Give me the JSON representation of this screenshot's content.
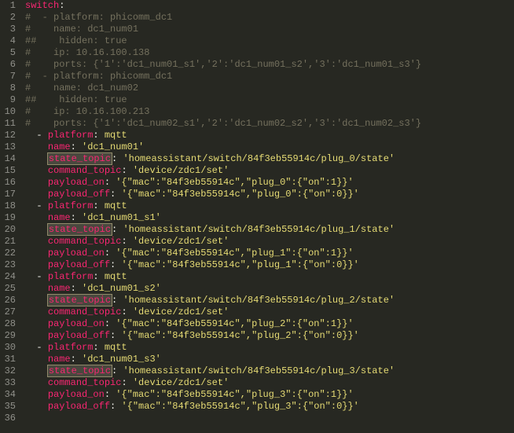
{
  "line_start": 1,
  "line_end": 36,
  "lines": [
    {
      "tokens": [
        {
          "t": "switch",
          "c": "key"
        },
        {
          "t": ":",
          "c": "punct"
        }
      ]
    },
    {
      "tokens": [
        {
          "t": "#  - platform: phicomm_dc1",
          "c": "cmt"
        }
      ]
    },
    {
      "tokens": [
        {
          "t": "#    name: dc1_num01",
          "c": "cmt"
        }
      ]
    },
    {
      "tokens": [
        {
          "t": "##    hidden: true",
          "c": "cmt"
        }
      ]
    },
    {
      "tokens": [
        {
          "t": "#    ip: 10.16.100.138",
          "c": "cmt"
        }
      ]
    },
    {
      "tokens": [
        {
          "t": "#    ports: {'1':'dc1_num01_s1','2':'dc1_num01_s2','3':'dc1_num01_s3'}",
          "c": "cmt"
        }
      ]
    },
    {
      "tokens": [
        {
          "t": "#  - platform: phicomm_dc1",
          "c": "cmt"
        }
      ]
    },
    {
      "tokens": [
        {
          "t": "#    name: dc1_num02",
          "c": "cmt"
        }
      ]
    },
    {
      "tokens": [
        {
          "t": "##    hidden: true",
          "c": "cmt"
        }
      ]
    },
    {
      "tokens": [
        {
          "t": "#    ip: 10.16.100.213",
          "c": "cmt"
        }
      ]
    },
    {
      "tokens": [
        {
          "t": "#    ports: {'1':'dc1_num02_s1','2':'dc1_num02_s2','3':'dc1_num02_s3'}",
          "c": "cmt"
        }
      ]
    },
    {
      "indent": "  ",
      "tokens": [
        {
          "t": "- ",
          "c": "punct"
        },
        {
          "t": "platform",
          "c": "key"
        },
        {
          "t": ": ",
          "c": "punct"
        },
        {
          "t": "mqtt",
          "c": "str"
        }
      ]
    },
    {
      "indent": "    ",
      "tokens": [
        {
          "t": "name",
          "c": "key"
        },
        {
          "t": ": ",
          "c": "punct"
        },
        {
          "t": "'dc1_num01'",
          "c": "str"
        }
      ]
    },
    {
      "indent": "    ",
      "tokens": [
        {
          "t": "state_topic",
          "c": "key",
          "sel": true
        },
        {
          "t": ": ",
          "c": "punct"
        },
        {
          "t": "'homeassistant/switch/84f3eb55914c/plug_0/state'",
          "c": "str"
        }
      ]
    },
    {
      "indent": "    ",
      "tokens": [
        {
          "t": "command_topic",
          "c": "key"
        },
        {
          "t": ": ",
          "c": "punct"
        },
        {
          "t": "'device/zdc1/set'",
          "c": "str"
        }
      ]
    },
    {
      "indent": "    ",
      "tokens": [
        {
          "t": "payload_on",
          "c": "key"
        },
        {
          "t": ": ",
          "c": "punct"
        },
        {
          "t": "'{\"mac\":\"84f3eb55914c\",\"plug_0\":{\"on\":1}}'",
          "c": "str"
        }
      ]
    },
    {
      "indent": "    ",
      "tokens": [
        {
          "t": "payload_off",
          "c": "key"
        },
        {
          "t": ": ",
          "c": "punct"
        },
        {
          "t": "'{\"mac\":\"84f3eb55914c\",\"plug_0\":{\"on\":0}}'",
          "c": "str"
        }
      ]
    },
    {
      "indent": "  ",
      "tokens": [
        {
          "t": "- ",
          "c": "punct"
        },
        {
          "t": "platform",
          "c": "key"
        },
        {
          "t": ": ",
          "c": "punct"
        },
        {
          "t": "mqtt",
          "c": "str"
        }
      ]
    },
    {
      "indent": "    ",
      "tokens": [
        {
          "t": "name",
          "c": "key"
        },
        {
          "t": ": ",
          "c": "punct"
        },
        {
          "t": "'dc1_num01_s1'",
          "c": "str"
        }
      ]
    },
    {
      "indent": "    ",
      "tokens": [
        {
          "t": "state_topic",
          "c": "key",
          "sel": true
        },
        {
          "t": ": ",
          "c": "punct"
        },
        {
          "t": "'homeassistant/switch/84f3eb55914c/plug_1/state'",
          "c": "str"
        }
      ]
    },
    {
      "indent": "    ",
      "tokens": [
        {
          "t": "command_topic",
          "c": "key"
        },
        {
          "t": ": ",
          "c": "punct"
        },
        {
          "t": "'device/zdc1/set'",
          "c": "str"
        }
      ]
    },
    {
      "indent": "    ",
      "tokens": [
        {
          "t": "payload_on",
          "c": "key"
        },
        {
          "t": ": ",
          "c": "punct"
        },
        {
          "t": "'{\"mac\":\"84f3eb55914c\",\"plug_1\":{\"on\":1}}'",
          "c": "str"
        }
      ]
    },
    {
      "indent": "    ",
      "tokens": [
        {
          "t": "payload_off",
          "c": "key"
        },
        {
          "t": ": ",
          "c": "punct"
        },
        {
          "t": "'{\"mac\":\"84f3eb55914c\",\"plug_1\":{\"on\":0}}'",
          "c": "str"
        }
      ]
    },
    {
      "indent": "  ",
      "tokens": [
        {
          "t": "- ",
          "c": "punct"
        },
        {
          "t": "platform",
          "c": "key"
        },
        {
          "t": ": ",
          "c": "punct"
        },
        {
          "t": "mqtt",
          "c": "str"
        }
      ]
    },
    {
      "indent": "    ",
      "tokens": [
        {
          "t": "name",
          "c": "key"
        },
        {
          "t": ": ",
          "c": "punct"
        },
        {
          "t": "'dc1_num01_s2'",
          "c": "str"
        }
      ]
    },
    {
      "indent": "    ",
      "tokens": [
        {
          "t": "state_topic",
          "c": "key",
          "sel": true
        },
        {
          "t": ": ",
          "c": "punct"
        },
        {
          "t": "'homeassistant/switch/84f3eb55914c/plug_2/state'",
          "c": "str"
        }
      ]
    },
    {
      "indent": "    ",
      "tokens": [
        {
          "t": "command_topic",
          "c": "key"
        },
        {
          "t": ": ",
          "c": "punct"
        },
        {
          "t": "'device/zdc1/set'",
          "c": "str"
        }
      ]
    },
    {
      "indent": "    ",
      "tokens": [
        {
          "t": "payload_on",
          "c": "key"
        },
        {
          "t": ": ",
          "c": "punct"
        },
        {
          "t": "'{\"mac\":\"84f3eb55914c\",\"plug_2\":{\"on\":1}}'",
          "c": "str"
        }
      ]
    },
    {
      "indent": "    ",
      "tokens": [
        {
          "t": "payload_off",
          "c": "key"
        },
        {
          "t": ": ",
          "c": "punct"
        },
        {
          "t": "'{\"mac\":\"84f3eb55914c\",\"plug_2\":{\"on\":0}}'",
          "c": "str"
        }
      ]
    },
    {
      "indent": "  ",
      "tokens": [
        {
          "t": "- ",
          "c": "punct"
        },
        {
          "t": "platform",
          "c": "key"
        },
        {
          "t": ": ",
          "c": "punct"
        },
        {
          "t": "mqtt",
          "c": "str"
        }
      ]
    },
    {
      "indent": "    ",
      "tokens": [
        {
          "t": "name",
          "c": "key"
        },
        {
          "t": ": ",
          "c": "punct"
        },
        {
          "t": "'dc1_num01_s3'",
          "c": "str"
        }
      ]
    },
    {
      "indent": "    ",
      "tokens": [
        {
          "t": "state_topic",
          "c": "key",
          "sel": true
        },
        {
          "t": ": ",
          "c": "punct"
        },
        {
          "t": "'homeassistant/switch/84f3eb55914c/plug_3/state'",
          "c": "str"
        }
      ]
    },
    {
      "indent": "    ",
      "tokens": [
        {
          "t": "command_topic",
          "c": "key"
        },
        {
          "t": ": ",
          "c": "punct"
        },
        {
          "t": "'device/zdc1/set'",
          "c": "str"
        }
      ]
    },
    {
      "indent": "    ",
      "tokens": [
        {
          "t": "payload_on",
          "c": "key"
        },
        {
          "t": ": ",
          "c": "punct"
        },
        {
          "t": "'{\"mac\":\"84f3eb55914c\",\"plug_3\":{\"on\":1}}'",
          "c": "str"
        }
      ]
    },
    {
      "indent": "    ",
      "tokens": [
        {
          "t": "payload_off",
          "c": "key"
        },
        {
          "t": ": ",
          "c": "punct"
        },
        {
          "t": "'{\"mac\":\"84f3eb55914c\",\"plug_3\":{\"on\":0}}'",
          "c": "str"
        }
      ]
    },
    {
      "tokens": []
    }
  ]
}
